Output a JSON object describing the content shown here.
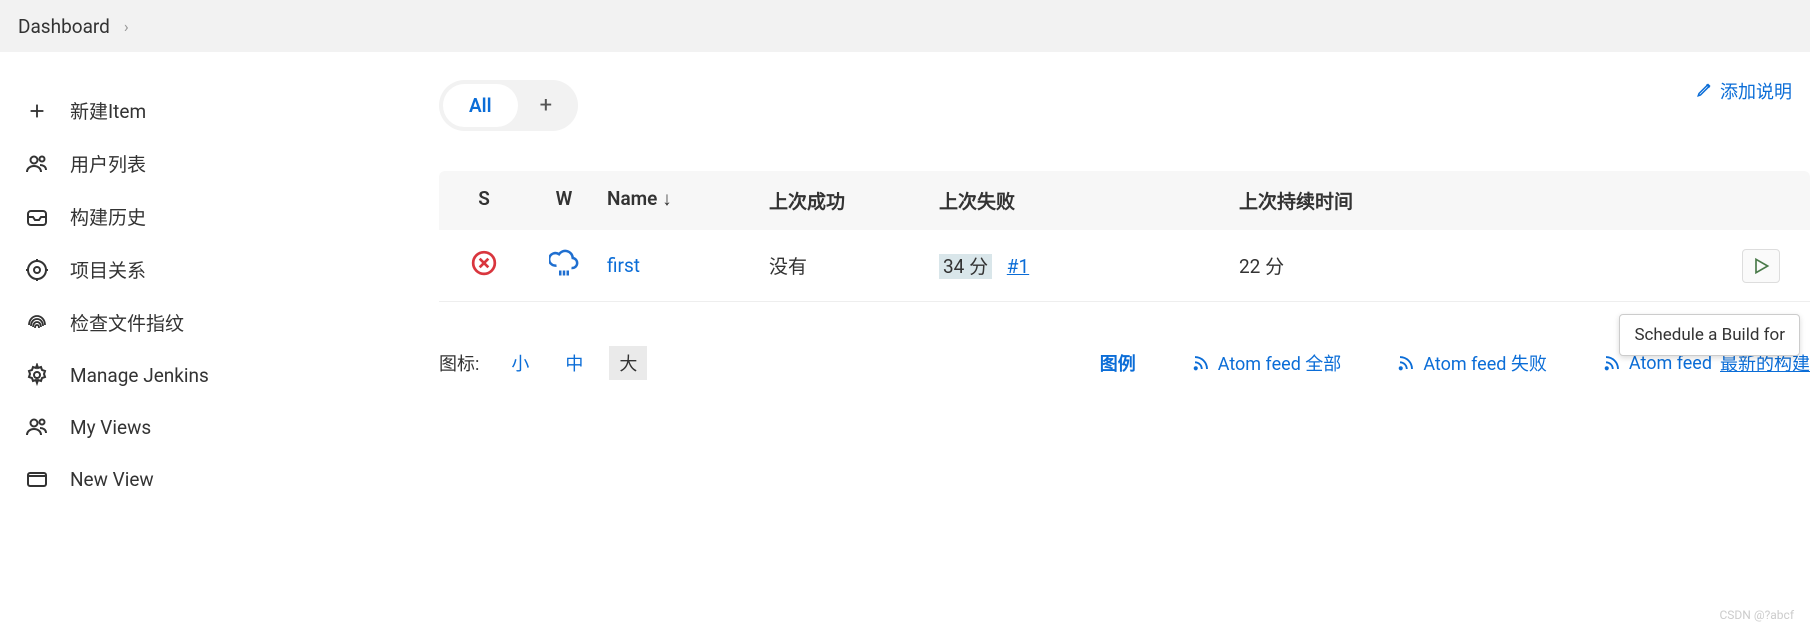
{
  "breadcrumb": {
    "title": "Dashboard"
  },
  "sidebar": {
    "items": [
      {
        "label": "新建Item"
      },
      {
        "label": "用户列表"
      },
      {
        "label": "构建历史"
      },
      {
        "label": "项目关系"
      },
      {
        "label": "检查文件指纹"
      },
      {
        "label": "Manage Jenkins"
      },
      {
        "label": "My Views"
      },
      {
        "label": "New View"
      }
    ]
  },
  "add_description": "添加说明",
  "tabs": {
    "all": "All"
  },
  "table": {
    "headers": {
      "s": "S",
      "w": "W",
      "name": "Name ↓",
      "last_success": "上次成功",
      "last_failure": "上次失败",
      "last_duration": "上次持续时间"
    },
    "rows": [
      {
        "name": "first",
        "last_success": "没有",
        "last_failure_time": "34 分",
        "last_failure_build": "#1",
        "last_duration": "22 分"
      }
    ]
  },
  "tooltip": "Schedule a Build for",
  "footer": {
    "icon_label": "图标:",
    "size_small": "小",
    "size_medium": "中",
    "size_large": "大",
    "legend": "图例",
    "atom_all": "Atom feed 全部",
    "atom_fail": "Atom feed 失败",
    "atom_latest_prefix": "Atom feed ",
    "atom_latest_ul": "最新的构建"
  },
  "watermark": "CSDN @?abcf"
}
